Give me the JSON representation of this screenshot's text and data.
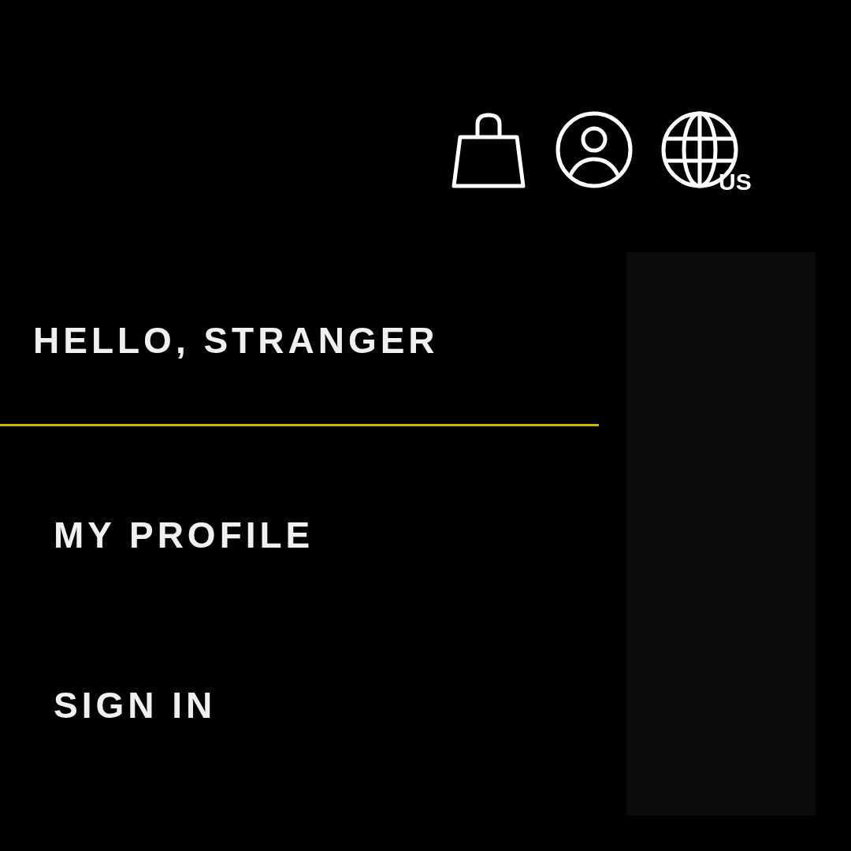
{
  "header": {
    "region_label": "US"
  },
  "menu": {
    "greeting": "HELLO, STRANGER",
    "items": [
      {
        "label": "MY PROFILE"
      },
      {
        "label": "SIGN IN"
      }
    ]
  }
}
